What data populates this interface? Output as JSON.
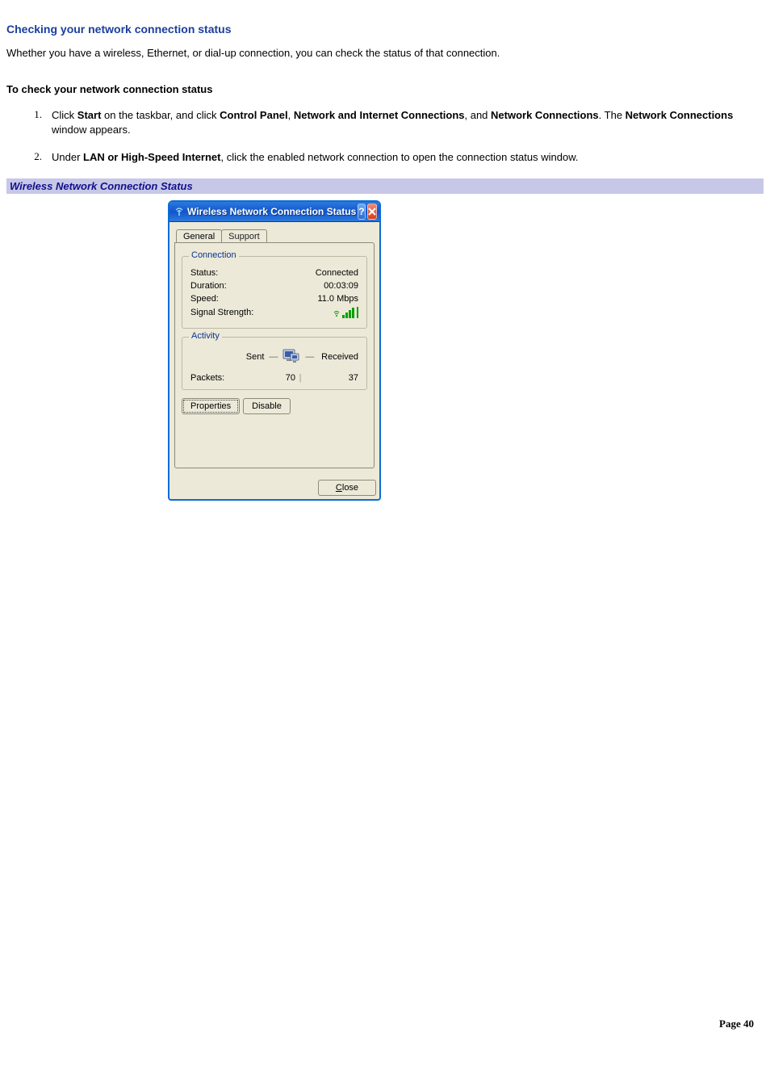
{
  "doc": {
    "heading": "Checking your network connection status",
    "intro": "Whether you have a wireless, Ethernet, or dial-up connection, you can check the status of that connection.",
    "subhead": "To check your network connection status",
    "steps": [
      {
        "num": "1.",
        "pre": "Click ",
        "b1": "Start",
        "mid1": " on the taskbar, and click ",
        "b2": "Control Panel",
        "mid2": ", ",
        "b3": "Network and Internet Connections",
        "mid3": ", and ",
        "b4": "Network Connections",
        "mid4": ". The ",
        "b5": "Network Connections",
        "post": " window appears."
      },
      {
        "num": "2.",
        "pre": "Under ",
        "b1": "LAN or High-Speed Internet",
        "post": ", click the enabled network connection to open the connection status window."
      }
    ],
    "band": "Wireless Network Connection Status",
    "page_label": "Page ",
    "page_num": "40"
  },
  "dialog": {
    "title": "Wireless Network Connection Status",
    "tabs": {
      "general": "General",
      "support": "Support"
    },
    "connection": {
      "legend": "Connection",
      "status_label": "Status:",
      "status_value": "Connected",
      "duration_label": "Duration:",
      "duration_value": "00:03:09",
      "speed_label": "Speed:",
      "speed_value": "11.0 Mbps",
      "signal_label": "Signal Strength:"
    },
    "activity": {
      "legend": "Activity",
      "sent": "Sent",
      "received": "Received",
      "packets_label": "Packets:",
      "packets_sent": "70",
      "packets_received": "37"
    },
    "buttons": {
      "properties": "Properties",
      "disable": "Disable",
      "close_pre": "C",
      "close_rest": "lose"
    }
  }
}
